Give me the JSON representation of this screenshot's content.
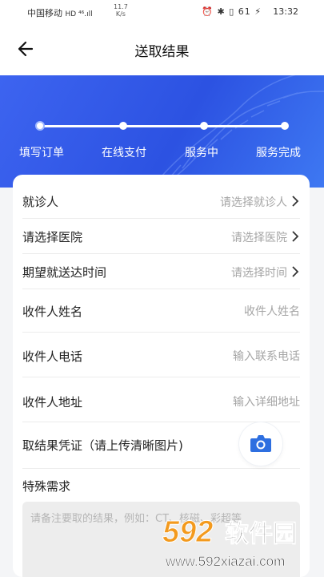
{
  "status_bar": {
    "carrier": "中国移动",
    "carrier_badges": "HD ⁴⁶.ıll",
    "speed_value": "11.7",
    "speed_unit": "K/s",
    "icons": "⏰ ✱ ▯ 61 ⚡",
    "time": "13:32"
  },
  "header": {
    "title": "送取结果"
  },
  "steps": [
    "填写订单",
    "在线支付",
    "服务中",
    "服务完成"
  ],
  "form": {
    "patient": {
      "label": "就诊人",
      "placeholder": "请选择就诊人"
    },
    "hospital": {
      "label": "请选择医院",
      "placeholder": "请选择医院"
    },
    "delivery_time": {
      "label": "期望就送达时间",
      "placeholder": "请选择时间"
    },
    "recipient_name": {
      "label": "收件人姓名",
      "placeholder": "收件人姓名"
    },
    "recipient_phone": {
      "label": "收件人电话",
      "placeholder": "输入联系电话"
    },
    "recipient_address": {
      "label": "收件人地址",
      "placeholder": "输入详细地址"
    },
    "voucher": {
      "label": "取结果凭证（请上传清晰图片)"
    },
    "special": {
      "label": "特殊需求",
      "placeholder": "请备注要取的结果，例如：CT、核磁、彩超等"
    }
  },
  "watermark": {
    "brand": "592软件园",
    "url": "www.592xiazai.com"
  },
  "colors": {
    "accent": "#2f57e6",
    "camera": "#2e6fe0"
  }
}
